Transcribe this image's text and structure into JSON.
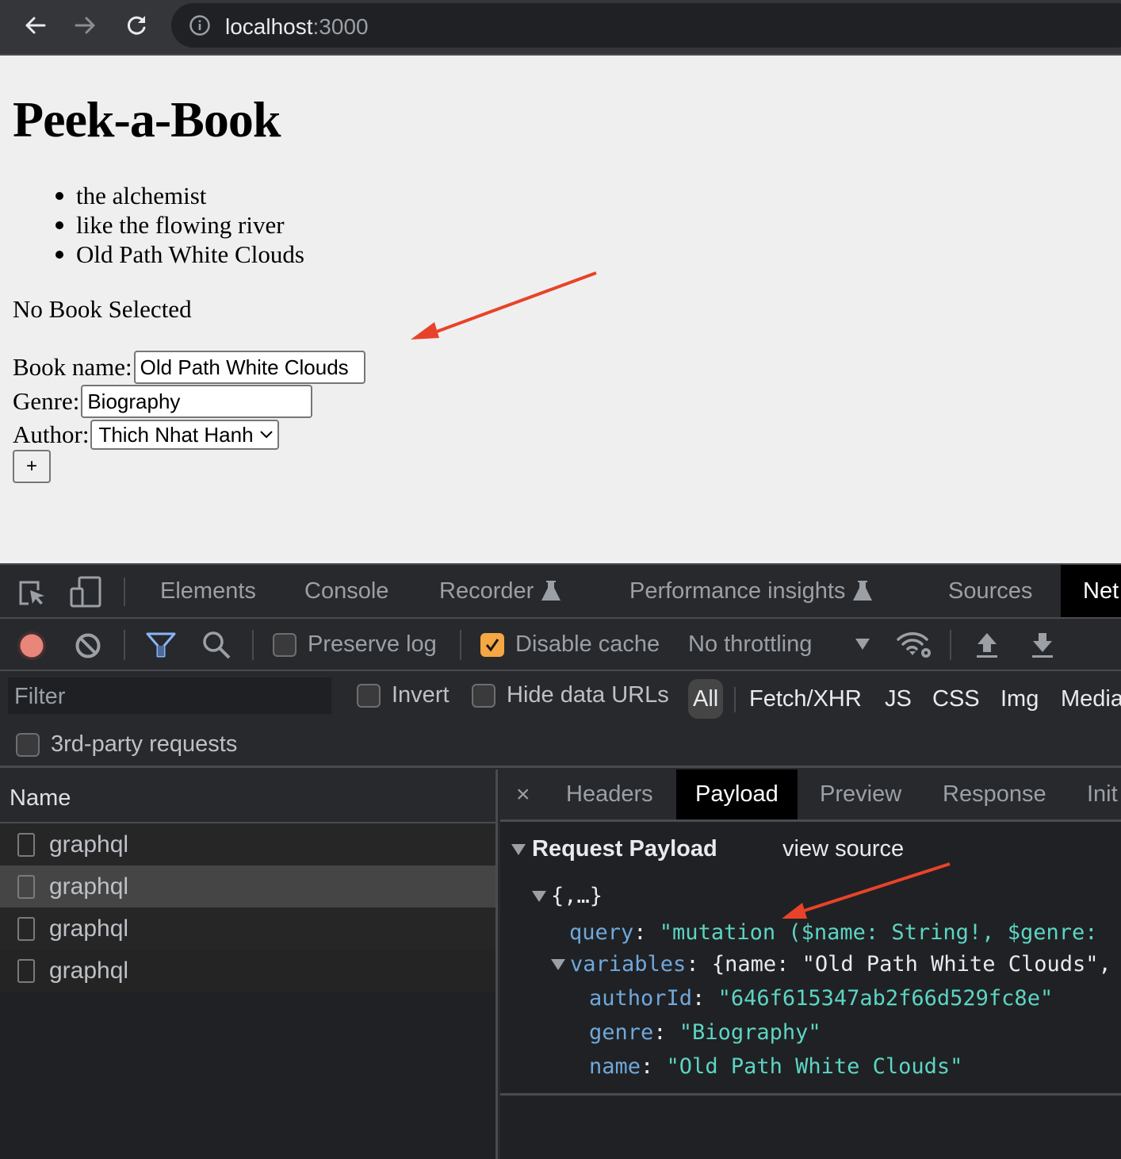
{
  "browser": {
    "url_host": "localhost",
    "url_port": ":3000",
    "icons": [
      "back-icon",
      "forward-icon",
      "reload-icon",
      "info-icon"
    ]
  },
  "page": {
    "title": "Peek-a-Book",
    "books": [
      "the alchemist",
      "like the flowing river",
      "Old Path White Clouds"
    ],
    "selection_status": "No Book Selected",
    "form": {
      "book_name_label": "Book name:",
      "book_name_value": "Old Path White Clouds",
      "genre_label": "Genre:",
      "genre_value": "Biography",
      "author_label": "Author:",
      "author_selected": "Thich Nhat Hanh",
      "add_button": "+"
    }
  },
  "devtools": {
    "tabs": [
      {
        "label": "Elements"
      },
      {
        "label": "Console"
      },
      {
        "label": "Recorder",
        "experimental": true
      },
      {
        "label": "Performance insights",
        "experimental": true
      },
      {
        "label": "Sources"
      },
      {
        "label": "Net",
        "active": true
      }
    ],
    "toolbar": {
      "preserve_log": "Preserve log",
      "preserve_log_checked": false,
      "disable_cache": "Disable cache",
      "disable_cache_checked": true,
      "throttling": "No throttling"
    },
    "filter": {
      "placeholder": "Filter",
      "invert": "Invert",
      "hide_data_urls": "Hide data URLs",
      "types": [
        "All",
        "Fetch/XHR",
        "JS",
        "CSS",
        "Img",
        "Media"
      ],
      "active_type": "All",
      "third_party": "3rd-party requests"
    },
    "requests": {
      "column_name": "Name",
      "rows": [
        "graphql",
        "graphql",
        "graphql",
        "graphql"
      ],
      "selected_index": 1
    },
    "detail": {
      "close": "×",
      "tabs": [
        "Headers",
        "Payload",
        "Preview",
        "Response",
        "Init"
      ],
      "active_tab": "Payload",
      "section_title": "Request Payload",
      "view_source": "view source",
      "root": "{,…}",
      "query_key": "query",
      "query_value": "\"mutation ($name: String!, $genre:",
      "variables_key": "variables",
      "variables_summary": "{name: \"Old Path White Clouds\",",
      "fields": [
        {
          "key": "authorId",
          "value": "\"646f615347ab2f66d529fc8e\""
        },
        {
          "key": "genre",
          "value": "\"Biography\""
        },
        {
          "key": "name",
          "value": "\"Old Path White Clouds\""
        }
      ]
    }
  },
  "annotations": {
    "arrow_color": "#e8432a",
    "arrows": [
      "arrow-to-form",
      "arrow-to-query"
    ]
  }
}
